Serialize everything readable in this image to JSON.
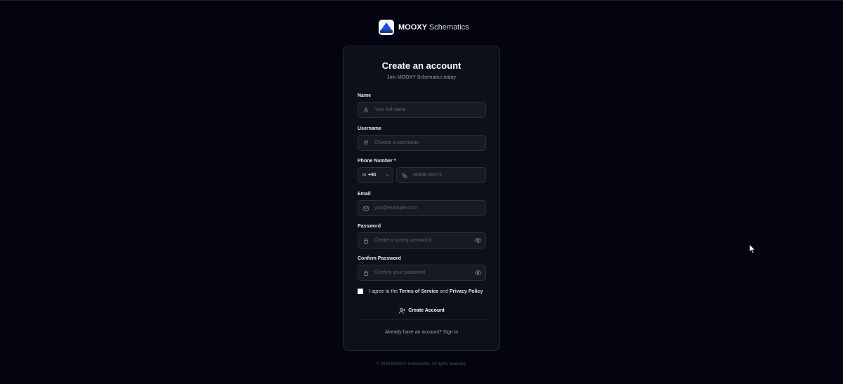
{
  "brand": {
    "name_bold": "MOOXY",
    "name_rest": "Schematics"
  },
  "form": {
    "title": "Create an account",
    "subtitle": "Join MOOXY Schematics today",
    "name": {
      "label": "Name",
      "placeholder": "Your full name"
    },
    "username": {
      "label": "Username",
      "placeholder": "Choose a username"
    },
    "phone": {
      "label": "Phone Number *",
      "country_flag": "IN",
      "country_code": "+91",
      "placeholder": "98938 39973"
    },
    "email": {
      "label": "Email",
      "placeholder": "you@example.com"
    },
    "password": {
      "label": "Password",
      "placeholder": "Create a strong password"
    },
    "confirm_password": {
      "label": "Confirm Password",
      "placeholder": "Confirm your password"
    },
    "terms": {
      "prefix": "I agree to the",
      "tos": "Terms of Service",
      "and": "and",
      "privacy": "Privacy Policy",
      "checked": false
    },
    "submit_label": "Create Account",
    "signin_prompt": "Already have an account?",
    "signin_link": "Sign in"
  },
  "footer": {
    "text": "© 2026 MOOXY Schematics. All rights reserved."
  },
  "icons": {
    "name": "user-icon",
    "username": "at-icon",
    "phone": "phone-icon",
    "email": "mail-icon",
    "password": "lock-icon",
    "toggle": "eye-icon",
    "submit": "user-plus-icon"
  },
  "colors": {
    "background": "#03040f",
    "card": "#0d1019",
    "input": "#161a25",
    "border": "#2b3140",
    "logo_blue": "#1d4ed8"
  }
}
